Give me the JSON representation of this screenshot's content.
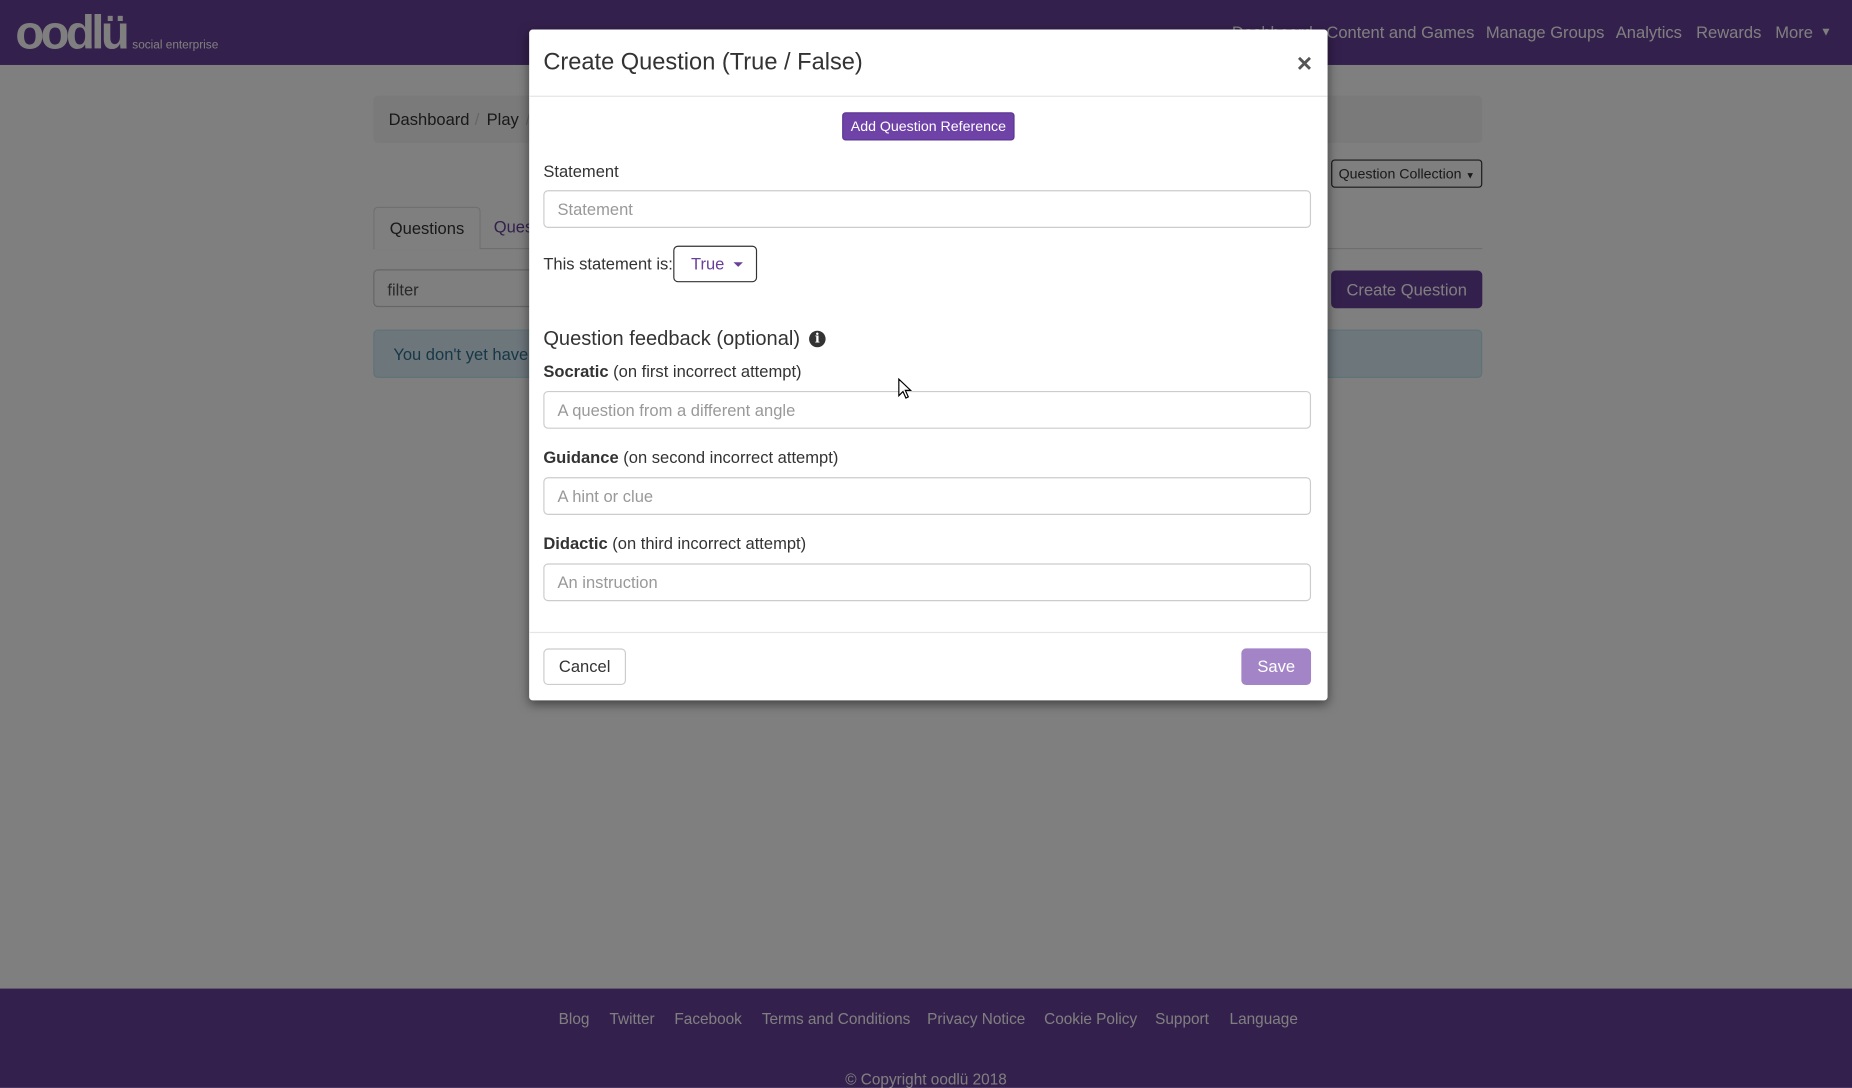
{
  "navbar": {
    "logo": "oodlü",
    "logo_sub": "social enterprise",
    "links": [
      "Dashboard",
      "Content and Games",
      "Manage Groups",
      "Analytics",
      "Rewards",
      "More"
    ]
  },
  "breadcrumb": [
    "Dashboard",
    "/",
    "Play",
    "/"
  ],
  "question_collection_label": "Question Collection",
  "tabs": [
    "Questions",
    "Ques"
  ],
  "filter_placeholder": "filter",
  "create_question_label": "Create Question",
  "alert_text": "You don't yet have",
  "footer": {
    "links": [
      "Blog",
      "Twitter",
      "Facebook",
      "Terms and Conditions",
      "Privacy Notice",
      "Cookie Policy",
      "Support",
      "Language"
    ],
    "copyright": "© Copyright oodlü 2018"
  },
  "modal": {
    "title": "Create Question (True / False)",
    "close": "×",
    "add_reference": "Add Question Reference",
    "statement_label": "Statement",
    "statement_placeholder": "Statement",
    "statement_is_label": "This statement is:",
    "statement_value": "True",
    "feedback_title": "Question feedback (optional)",
    "info_icon": "i",
    "socratic": {
      "bold": "Socratic",
      "rest": " (on first incorrect attempt)",
      "placeholder": "A question from a different angle"
    },
    "guidance": {
      "bold": "Guidance",
      "rest": " (on second incorrect attempt)",
      "placeholder": "A hint or clue"
    },
    "didactic": {
      "bold": "Didactic",
      "rest": " (on third incorrect attempt)",
      "placeholder": "An instruction"
    },
    "cancel": "Cancel",
    "save": "Save"
  },
  "colors": {
    "brand": "#68409a",
    "save_disabled": "#a385c7"
  }
}
